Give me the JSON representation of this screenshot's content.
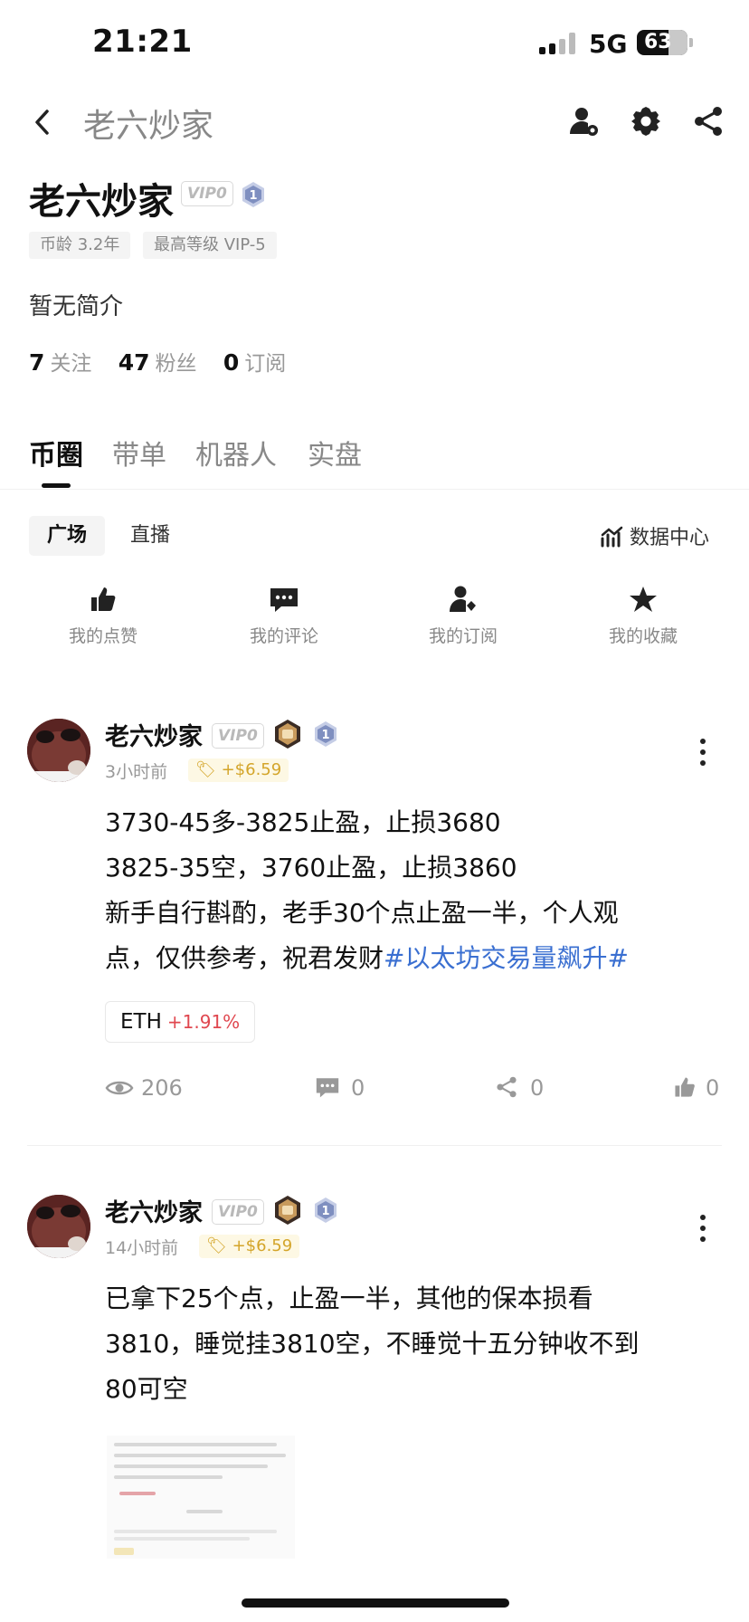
{
  "status_bar": {
    "time": "21:21",
    "network": "5G",
    "battery": "63",
    "battery_level": 0.63
  },
  "header": {
    "title": "老六炒家",
    "icons": [
      "chevron-left-icon",
      "user-settings-icon",
      "gear-icon",
      "share-icon"
    ]
  },
  "profile": {
    "name": "老六炒家",
    "vip": "VIP0",
    "level_badge": "1",
    "chips": [
      "币龄 3.2年",
      "最高等级 VIP-5"
    ],
    "bio": "暂无简介",
    "stats": [
      {
        "value": "7",
        "label": "关注"
      },
      {
        "value": "47",
        "label": "粉丝"
      },
      {
        "value": "0",
        "label": "订阅"
      }
    ]
  },
  "tabs": [
    "币圈",
    "带单",
    "机器人",
    "实盘"
  ],
  "subtabs": [
    "广场",
    "直播"
  ],
  "data_center": "数据中心",
  "quick_actions": [
    "我的点赞",
    "我的评论",
    "我的订阅",
    "我的收藏"
  ],
  "posts": [
    {
      "author": "老六炒家",
      "vip": "VIP0",
      "level": "1",
      "time": "3小时前",
      "tip": "+$6.59",
      "lines": [
        "3730-45多-3825止盈，止损3680",
        "3825-35空，3760止盈，止损3860",
        "新手自行斟酌，老手30个点止盈一半，个人观",
        "点，仅供参考，祝君发财"
      ],
      "hashtag": "#以太坊交易量飙升#",
      "coin": {
        "symbol": "ETH",
        "change": "+1.91%"
      },
      "actions": {
        "views": "206",
        "comments": "0",
        "shares": "0",
        "likes": "0"
      }
    },
    {
      "author": "老六炒家",
      "vip": "VIP0",
      "level": "1",
      "time": "14小时前",
      "tip": "+$6.59",
      "lines": [
        "已拿下25个点，止盈一半，其他的保本损看",
        "3810，睡觉挂3810空，不睡觉十五分钟收不到",
        "80可空"
      ]
    }
  ]
}
